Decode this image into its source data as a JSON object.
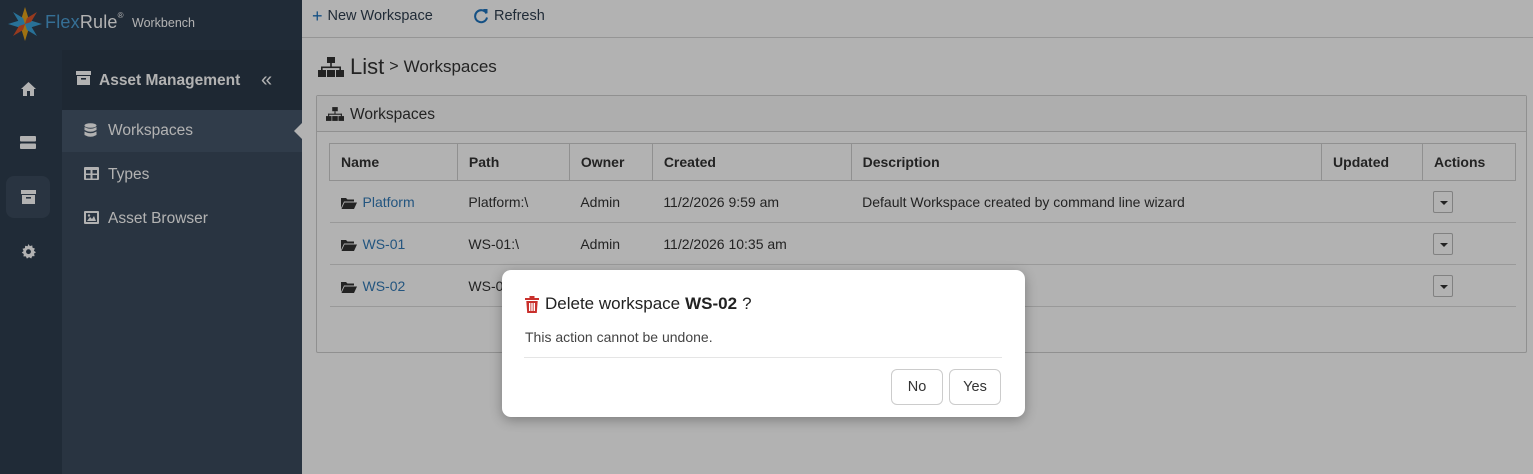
{
  "brand": {
    "name_a": "Flex",
    "name_b": "Rule",
    "mark": "®",
    "sub": "Workbench"
  },
  "rail": {
    "items": [
      {
        "icon": "home-icon"
      },
      {
        "icon": "server-icon"
      },
      {
        "icon": "archive-icon"
      },
      {
        "icon": "gear-icon"
      }
    ]
  },
  "panel": {
    "title": "Asset Management",
    "collapse": "«",
    "items": [
      {
        "label": "Workspaces",
        "icon": "database-icon"
      },
      {
        "label": "Types",
        "icon": "table-icon"
      },
      {
        "label": "Asset Browser",
        "icon": "image-icon"
      }
    ]
  },
  "toolbar": {
    "new_label": "New Workspace",
    "refresh_label": "Refresh"
  },
  "breadcrumb": {
    "main": "List",
    "sep": ">",
    "sub": "Workspaces"
  },
  "card": {
    "title": "Workspaces"
  },
  "table": {
    "headers": [
      "Name",
      "Path",
      "Owner",
      "Created",
      "Description",
      "Updated",
      "Actions"
    ],
    "rows": [
      {
        "name": "Platform",
        "path": "Platform:\\",
        "owner": "Admin",
        "created": "11/2/2026 9:59 am",
        "description": "Default Workspace created by command line wizard",
        "updated": ""
      },
      {
        "name": "WS-01",
        "path": "WS-01:\\",
        "owner": "Admin",
        "created": "11/2/2026 10:35 am",
        "description": "",
        "updated": ""
      },
      {
        "name": "WS-02",
        "path": "WS-0",
        "owner": "",
        "created": "",
        "description": "",
        "updated": ""
      }
    ]
  },
  "modal": {
    "title_prefix": "Delete workspace",
    "title_target": "WS-02",
    "title_suffix": "?",
    "body": "This action cannot be undone.",
    "no_label": "No",
    "yes_label": "Yes"
  },
  "colors": {
    "sidebar": "#2f3e4f",
    "panel": "#3b4b5d",
    "link": "#337ab7",
    "danger": "#c9302c"
  }
}
